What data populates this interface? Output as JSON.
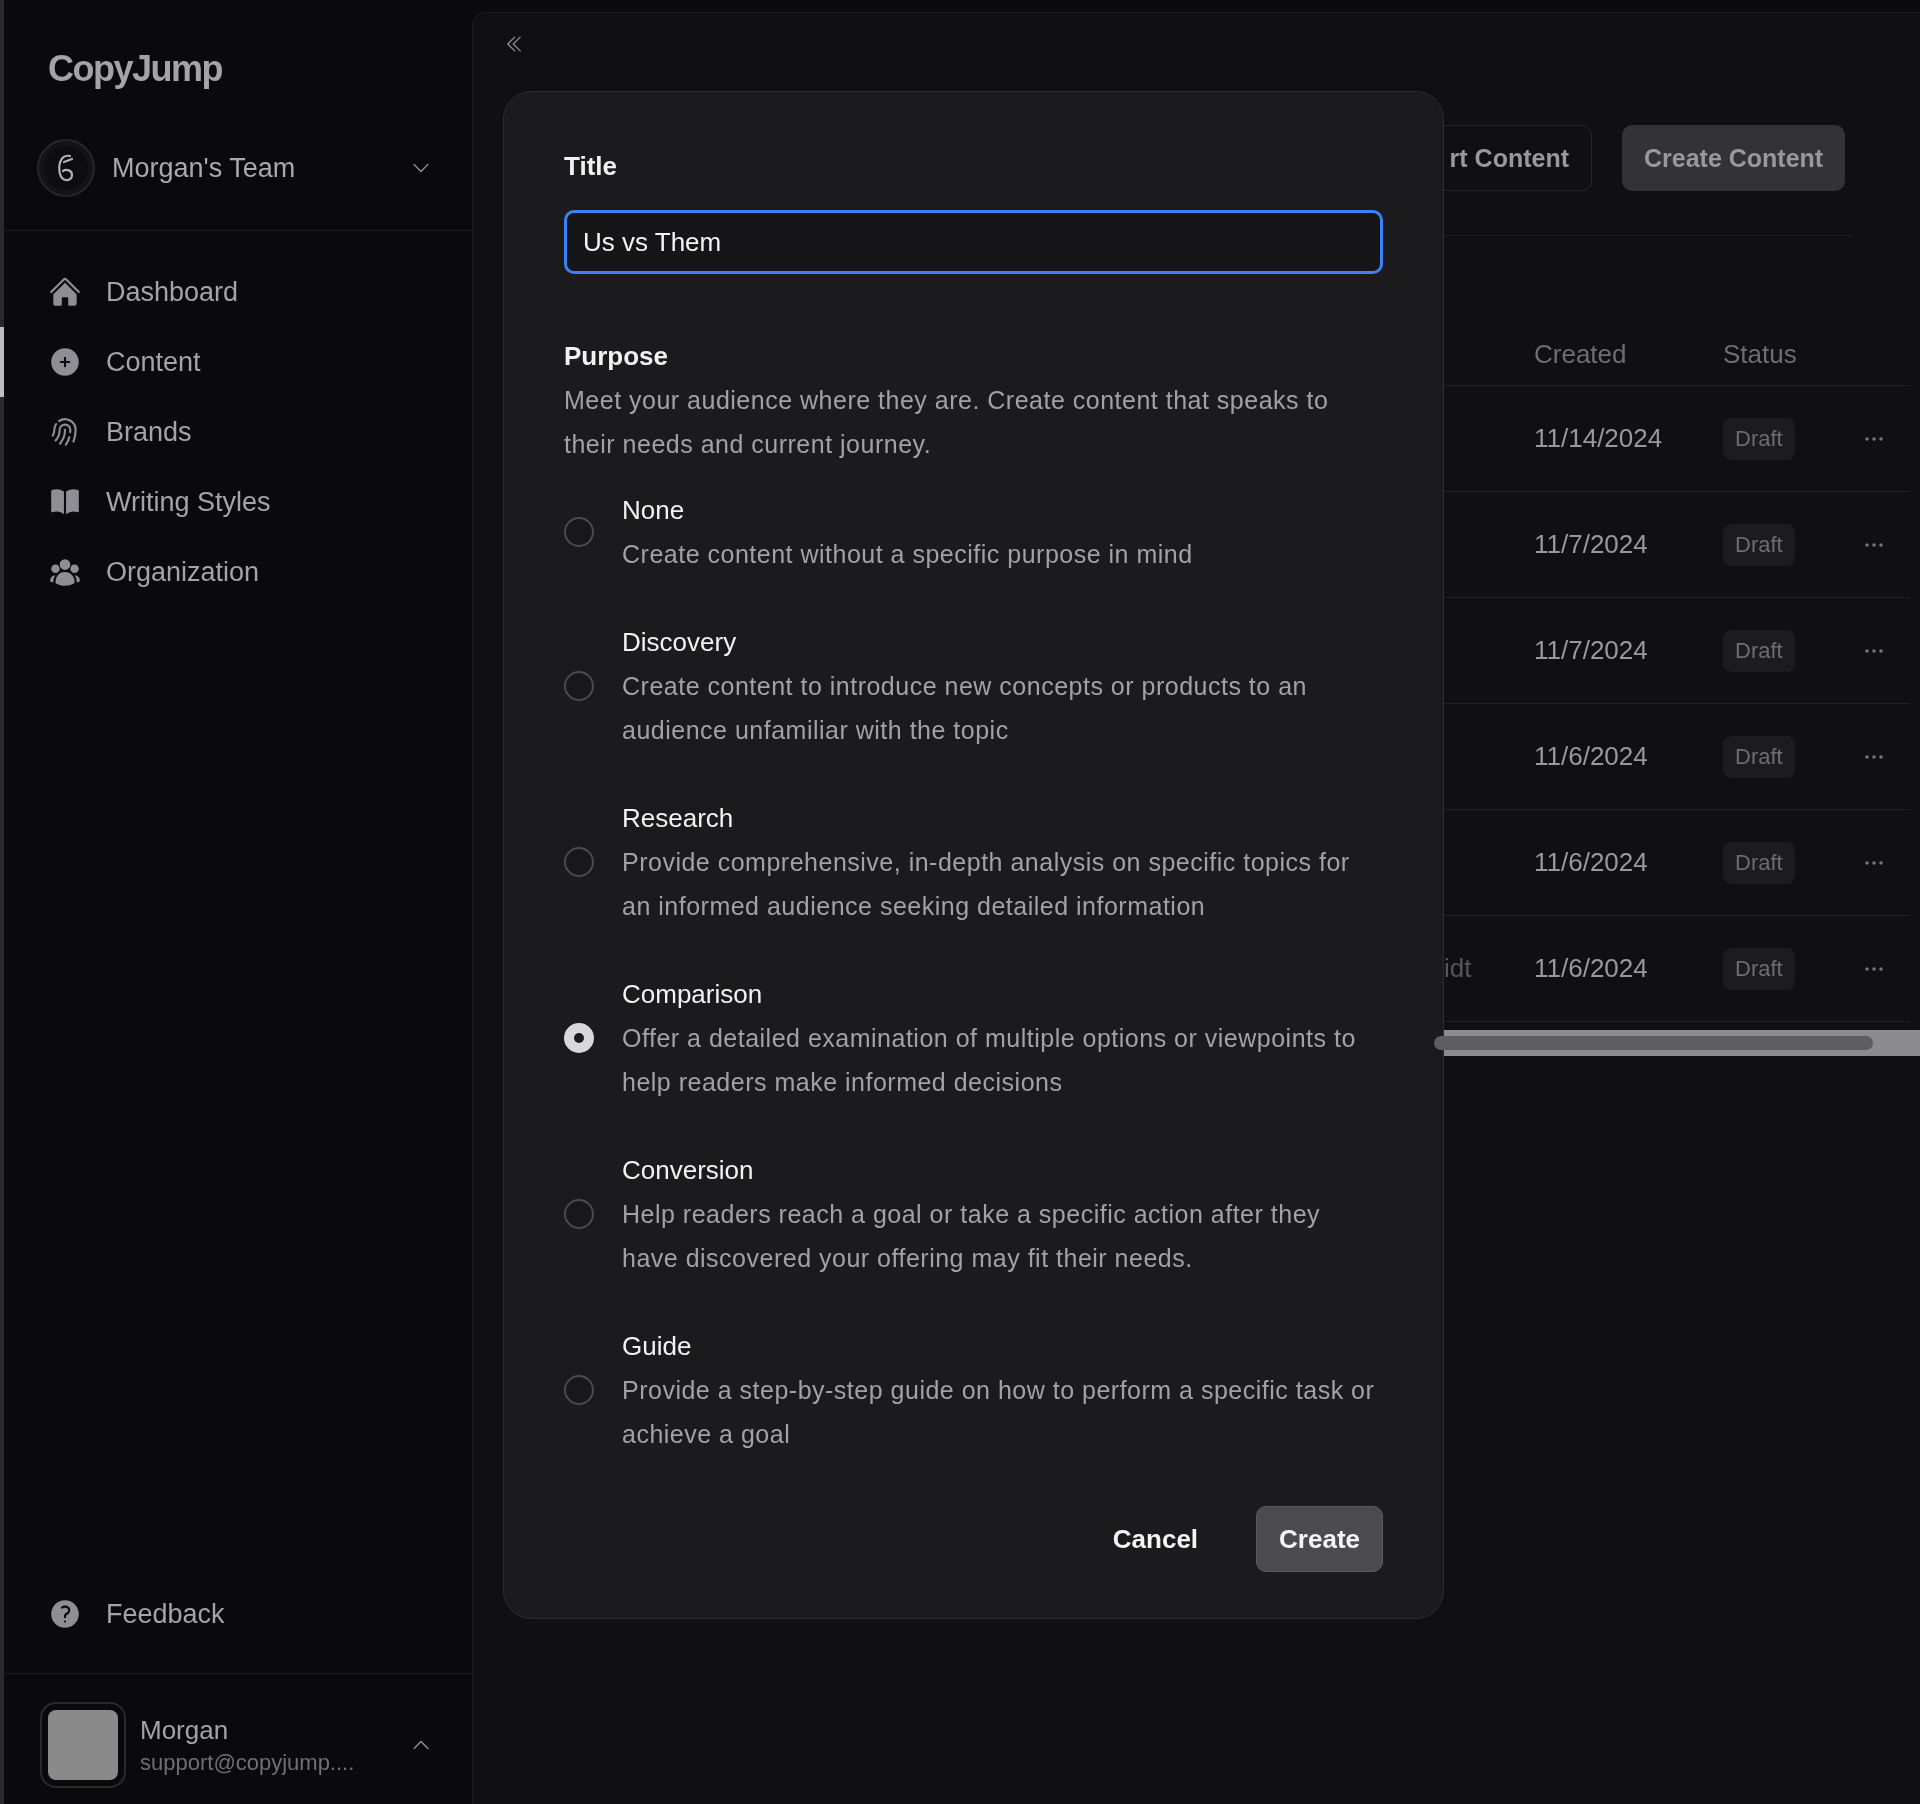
{
  "sidebar": {
    "logo": "CopyJump",
    "team": {
      "name": "Morgan's Team"
    },
    "nav": [
      {
        "label": "Dashboard",
        "selected": false
      },
      {
        "label": "Content",
        "selected": true
      },
      {
        "label": "Brands",
        "selected": false
      },
      {
        "label": "Writing Styles",
        "selected": false
      },
      {
        "label": "Organization",
        "selected": false
      }
    ],
    "footer_links": [
      {
        "label": "Feedback"
      }
    ],
    "user": {
      "name": "Morgan",
      "email": "support@copyjump...."
    }
  },
  "header": {
    "buttons": [
      {
        "label": "rt Content",
        "kind": "secondary"
      },
      {
        "label": "Create Content",
        "kind": "primary"
      }
    ]
  },
  "table": {
    "columns": [
      "Created",
      "Status"
    ],
    "rows": [
      {
        "created": "11/14/2024",
        "status": "Draft"
      },
      {
        "created": "11/7/2024",
        "status": "Draft"
      },
      {
        "created": "11/7/2024",
        "status": "Draft"
      },
      {
        "created": "11/6/2024",
        "status": "Draft"
      },
      {
        "created": "11/6/2024",
        "status": "Draft"
      },
      {
        "column_1": "idt",
        "created": "11/6/2024",
        "status": "Draft"
      }
    ]
  },
  "dialog": {
    "title_field": {
      "label": "Title",
      "value": "Us vs Them"
    },
    "purpose": {
      "label": "Purpose",
      "description": "Meet your audience where they are. Create content that speaks to their needs and current journey."
    },
    "options": [
      {
        "title": "None",
        "description": "Create content without a specific purpose in mind",
        "selected": false
      },
      {
        "title": "Discovery",
        "description": "Create content to introduce new concepts or products to an audience unfamiliar with the topic",
        "selected": false
      },
      {
        "title": "Research",
        "description": "Provide comprehensive, in-depth analysis on specific topics for an informed audience seeking detailed information",
        "selected": false
      },
      {
        "title": "Comparison",
        "description": "Offer a detailed examination of multiple options or viewpoints to help readers make informed decisions",
        "selected": true
      },
      {
        "title": "Conversion",
        "description": "Help readers reach a goal or take a specific action after they have discovered your offering may fit their needs.",
        "selected": false
      },
      {
        "title": "Guide",
        "description": "Provide a step-by-step guide on how to perform a specific task or achieve a goal",
        "selected": false
      }
    ],
    "buttons": [
      {
        "label": "Cancel",
        "kind": "ghost"
      },
      {
        "label": "Create",
        "kind": "primary"
      }
    ]
  }
}
